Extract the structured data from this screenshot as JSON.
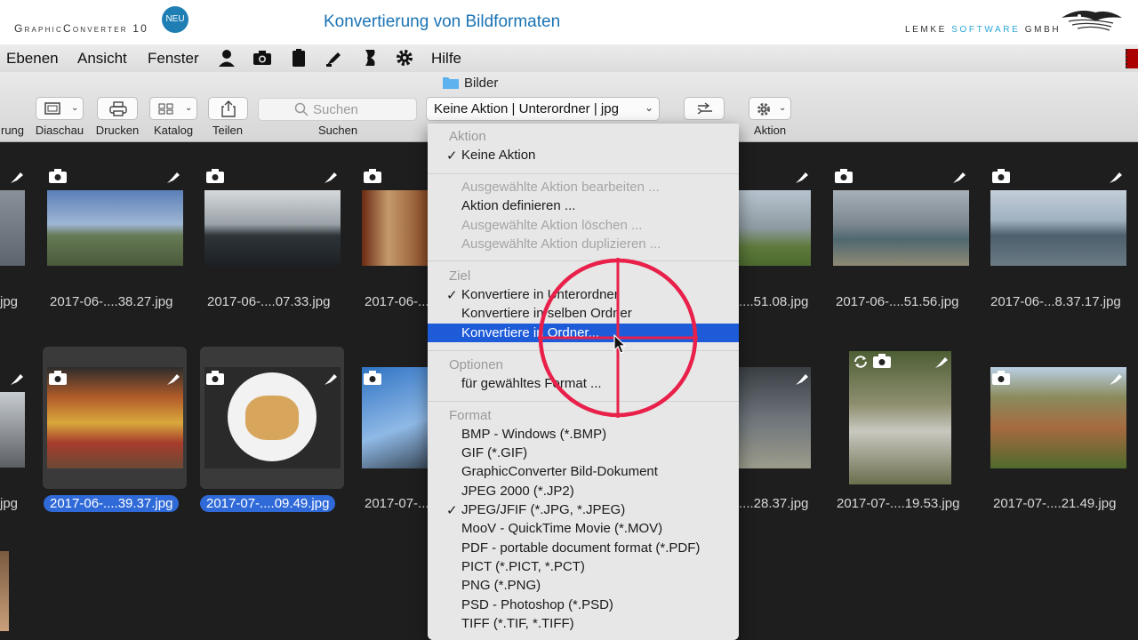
{
  "banner": {
    "brand": "GraphicConverter 10",
    "badge": "NEU",
    "title": "Konvertierung von Bildformaten",
    "company_a": "LEMKE ",
    "company_b": "SOFTWARE",
    "company_c": " GMBH"
  },
  "menubar": {
    "items": [
      "Ebenen",
      "Ansicht",
      "Fenster",
      "Hilfe"
    ],
    "icons": [
      "person-icon",
      "camera-icon",
      "clipboard-icon",
      "pen-icon",
      "script-icon",
      "gear-icon"
    ]
  },
  "window": {
    "folder": "Bilder"
  },
  "toolbar": {
    "labels": [
      "rung",
      "Diaschau",
      "Drucken",
      "Katalog",
      "Teilen",
      "Suchen",
      "Aktion"
    ],
    "search_placeholder": "Suchen",
    "action_popup": "Keine Aktion | Unterordner | jpg"
  },
  "files": {
    "row1": [
      "jpg",
      "2017-06-....38.27.jpg",
      "2017-06-....07.33.jpg",
      "2017-06-...",
      "....51.08.jpg",
      "2017-06-....51.56.jpg",
      "2017-06-...8.37.17.jpg"
    ],
    "row2": [
      "jpg",
      "2017-06-....39.37.jpg",
      "2017-07-....09.49.jpg",
      "2017-07-...",
      "....28.37.jpg",
      "2017-07-....19.53.jpg",
      "2017-07-....21.49.jpg"
    ]
  },
  "dropdown": {
    "aktion_head": "Aktion",
    "keine_aktion": "Keine Aktion",
    "bearbeiten": "Ausgewählte Aktion bearbeiten ...",
    "definieren": "Aktion definieren ...",
    "loeschen": "Ausgewählte Aktion löschen ...",
    "duplizieren": "Ausgewählte Aktion duplizieren ...",
    "ziel_head": "Ziel",
    "ziel_items": [
      "Konvertiere in Unterordner",
      "Konvertiere in selben Ordner",
      "Konvertiere in Ordner..."
    ],
    "optionen_head": "Optionen",
    "optionen_item": "für gewähltes Format ...",
    "format_head": "Format",
    "formats": [
      "BMP - Windows (*.BMP)",
      "GIF (*.GIF)",
      "GraphicConverter Bild-Dokument",
      "JPEG 2000 (*.JP2)",
      "JPEG/JFIF (*.JPG, *.JPEG)",
      "MooV - QuickTime Movie (*.MOV)",
      "PDF - portable document format (*.PDF)",
      "PICT (*.PICT, *.PCT)",
      "PNG (*.PNG)",
      "PSD - Photoshop (*.PSD)",
      "TIFF (*.TIF, *.TIFF)"
    ]
  },
  "colors": {
    "accent": "#1e5bd8",
    "crosshair": "#e8204a",
    "brand_blue": "#1a73b5"
  }
}
